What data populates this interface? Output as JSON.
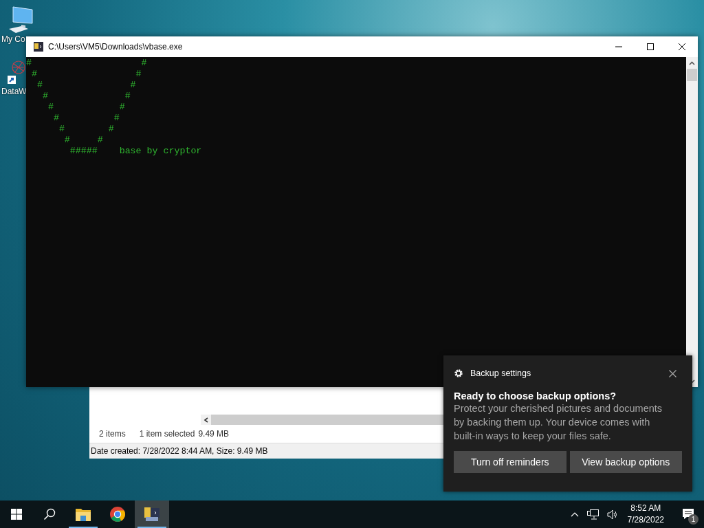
{
  "desktop_icons": [
    {
      "label": "My Co",
      "kind": "computer"
    },
    {
      "label": "DataW",
      "kind": "shortcut"
    }
  ],
  "console_window": {
    "title": "C:\\Users\\VM5\\Downloads\\vbase.exe",
    "lines": [
      "#                    #",
      " #                  #",
      "  #                #",
      "   #              #",
      "    #            #",
      "     #          #",
      "      #        #",
      "       #     #",
      "        #####    base by cryptor"
    ]
  },
  "explorer_window": {
    "status_items": [
      "2 items",
      "1 item selected",
      "9.49 MB"
    ],
    "details": "Date created: 7/28/2022 8:44 AM, Size: 9.49 MB"
  },
  "notification": {
    "app": "Backup settings",
    "title": "Ready to choose backup options?",
    "body": "Protect your cherished pictures and documents by backing them up. Your device comes with built-in ways to keep your files safe.",
    "buttons": [
      "Turn off reminders",
      "View backup options"
    ]
  },
  "taskbar": {
    "apps": [
      {
        "kind": "explorer",
        "running": true,
        "selected": false
      },
      {
        "kind": "chrome",
        "running": false,
        "selected": false
      },
      {
        "kind": "console",
        "running": true,
        "selected": true
      }
    ],
    "time": "8:52 AM",
    "date": "7/28/2022",
    "notification_count": "1"
  }
}
